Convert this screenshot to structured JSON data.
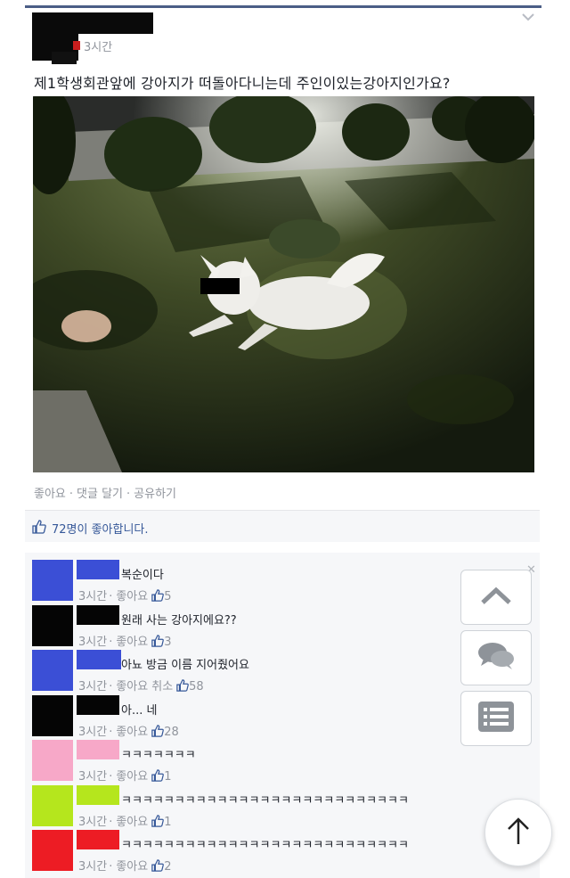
{
  "post": {
    "timestamp": "3시간",
    "text": "제1학생회관앞에 강아지가 떠돌아다니는데 주인이있는강아지인가요?"
  },
  "actions": {
    "like": "좋아요",
    "comment": "댓글 달기",
    "share": "공유하기",
    "separator": "·"
  },
  "likes_summary": "72명이 좋아합니다.",
  "comments": [
    {
      "text": "복순이다",
      "time": "3시간",
      "like": "좋아요",
      "extra": "",
      "count": "5",
      "avatar_color": "#3b4fd6",
      "name_color": "#3b4fd6"
    },
    {
      "text": "원래 사는 강아지에요??",
      "time": "3시간",
      "like": "좋아요",
      "extra": "",
      "count": "3",
      "avatar_color": "#050505",
      "name_color": "#050505"
    },
    {
      "text": "아뇨 방금 이름 지어줬어요",
      "time": "3시간",
      "like": "좋아요",
      "extra": "취소",
      "count": "58",
      "avatar_color": "#3b4fd6",
      "name_color": "#3b4fd6"
    },
    {
      "text": "아... 네",
      "time": "3시간",
      "like": "좋아요",
      "extra": "",
      "count": "28",
      "avatar_color": "#050505",
      "name_color": "#050505"
    },
    {
      "text": "ㅋㅋㅋㅋㅋㅋㅋ",
      "time": "3시간",
      "like": "좋아요",
      "extra": "",
      "count": "1",
      "avatar_color": "#f7a8c8",
      "name_color": "#f7a8c8"
    },
    {
      "text": "ㅋㅋㅋㅋㅋㅋㅋㅋㅋㅋㅋㅋㅋㅋㅋㅋㅋㅋㅋㅋㅋㅋㅋㅋㅋㅋㅋ",
      "time": "3시간",
      "like": "좋아요",
      "extra": "",
      "count": "1",
      "avatar_color": "#b5e61d",
      "name_color": "#b5e61d"
    },
    {
      "text": "ㅋㅋㅋㅋㅋㅋㅋㅋㅋㅋㅋㅋㅋㅋㅋㅋㅋㅋㅋㅋㅋㅋㅋㅋㅋㅋㅋ",
      "time": "3시간",
      "like": "좋아요",
      "extra": "",
      "count": "2",
      "avatar_color": "#ed1c24",
      "name_color": "#ed1c24"
    }
  ],
  "colors": {
    "link": "#365899",
    "meta": "#90949c",
    "header_line": "#4b5e86"
  },
  "icons": {
    "side_up": "chevron-up-icon",
    "side_chat": "chat-bubbles-icon",
    "side_list": "list-icon",
    "scroll_top": "arrow-up-icon",
    "like": "thumbs-up-icon"
  }
}
